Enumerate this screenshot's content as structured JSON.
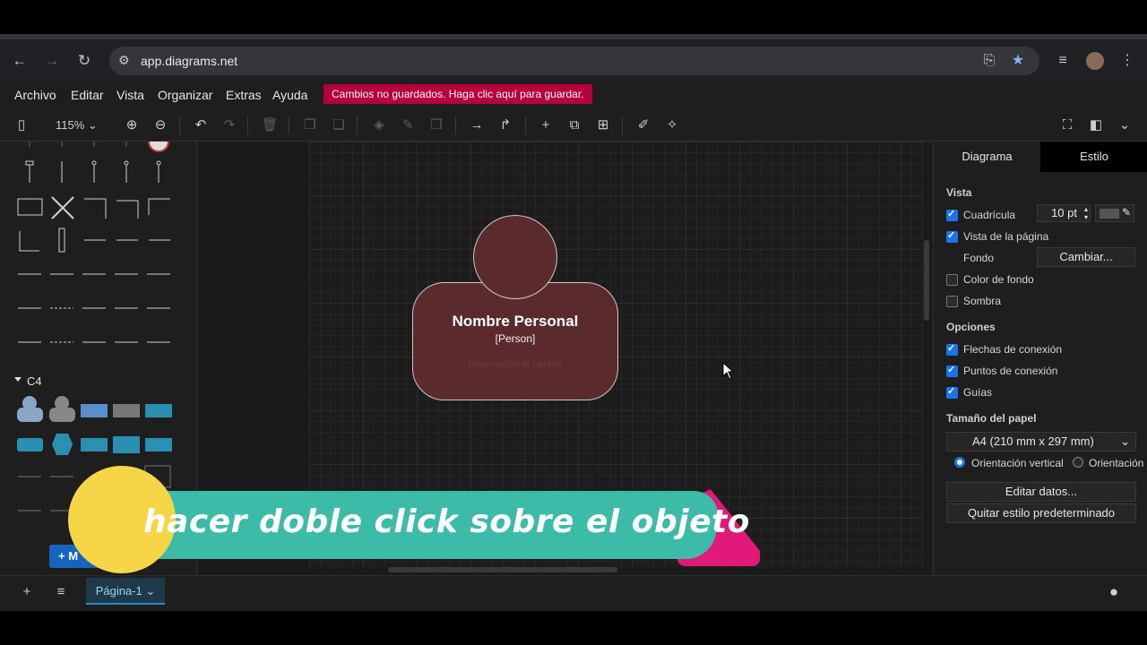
{
  "browser": {
    "url": "app.diagrams.net"
  },
  "menu": {
    "items": [
      "Archivo",
      "Editar",
      "Vista",
      "Organizar",
      "Extras",
      "Ayuda"
    ],
    "unsaved_notice": "Cambios no guardados. Haga clic aquí para guardar."
  },
  "toolbar": {
    "zoom": "115%"
  },
  "sidebar": {
    "c4_title": "C4",
    "more_label": "+ M"
  },
  "canvas": {
    "person": {
      "name": "Nombre Personal",
      "type": "[Person]",
      "description": "Descripción el persón"
    }
  },
  "panel": {
    "tabs": [
      "Diagrama",
      "Estilo"
    ],
    "vista_title": "Vista",
    "grid_label": "Cuadrícula",
    "grid_size": "10 pt",
    "page_view_label": "Vista de la página",
    "background_label": "Fondo",
    "change_button": "Cambiar...",
    "bg_color_label": "Color de fondo",
    "shadow_label": "Sombra",
    "options_title": "Opciones",
    "connection_arrows_label": "Flechas de conexión",
    "connection_points_label": "Puntos de conexión",
    "guides_label": "Guías",
    "paper_size_title": "Tamaño del papel",
    "paper_size_value": "A4 (210 mm x 297 mm)",
    "orientation_vertical": "Orientación vertical",
    "orientation_horizontal": "Orientación",
    "edit_data_button": "Editar datos...",
    "remove_style_button": "Quitar estilo predeterminado"
  },
  "bottom": {
    "page_tab": "Página-1"
  },
  "overlay": {
    "caption": "hacer doble click sobre el objeto"
  },
  "colors": {
    "accent": "#1a73e8",
    "person_fill": "#5a2a2c",
    "unsaved_bg": "#b5003b"
  }
}
